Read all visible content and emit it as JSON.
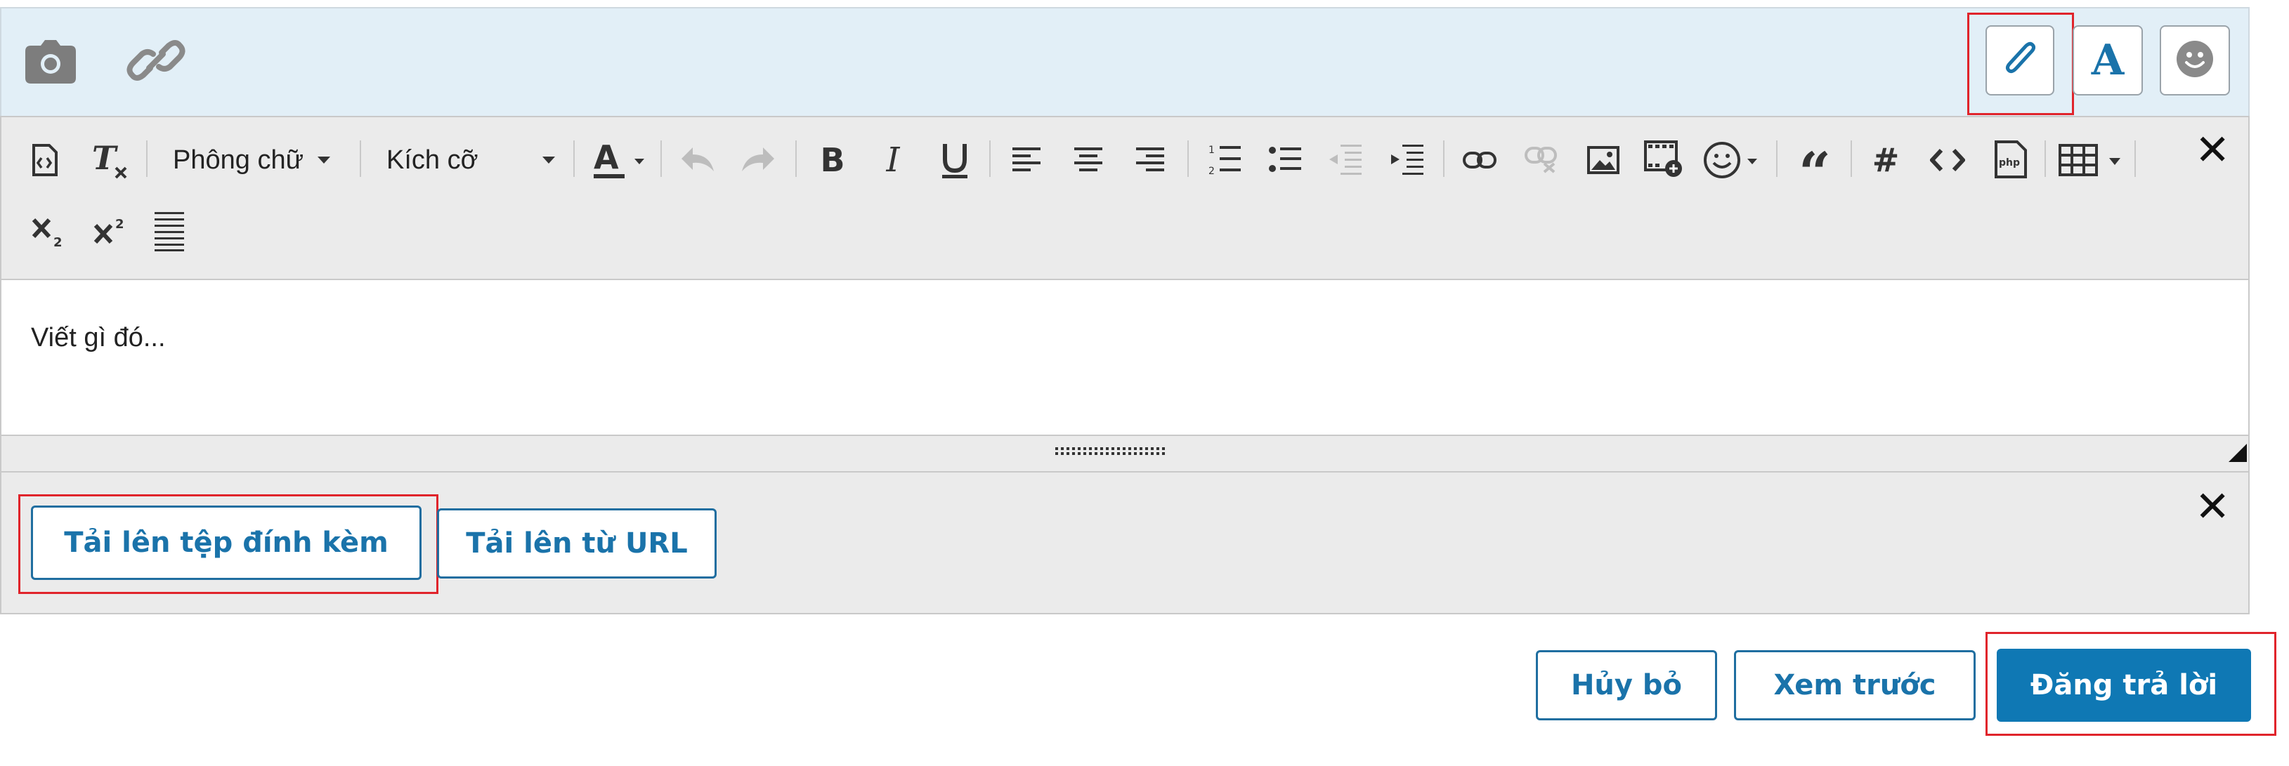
{
  "toolbar_top": {
    "left_icons": [
      "camera-icon",
      "link-icon"
    ],
    "right_icons": [
      "paperclip-icon",
      "font-a-icon",
      "smiley-icon"
    ]
  },
  "format_toolbar": {
    "font_label": "Phông chữ",
    "size_label": "Kích cỡ",
    "icons": [
      "source-icon",
      "remove-format-icon",
      "text-color-icon",
      "undo-icon",
      "redo-icon",
      "bold-icon",
      "italic-icon",
      "underline-icon",
      "align-left-icon",
      "align-center-icon",
      "align-right-icon",
      "ordered-list-icon",
      "unordered-list-icon",
      "outdent-icon",
      "indent-icon",
      "insert-link-icon",
      "unlink-icon",
      "image-icon",
      "media-icon",
      "emoji-icon",
      "quote-icon",
      "hashtag-icon",
      "code-icon",
      "php-icon",
      "table-icon",
      "subscript-icon",
      "superscript-icon",
      "justify-icon",
      "close-icon"
    ]
  },
  "editor": {
    "placeholder": "Viết gì đó..."
  },
  "attachments": {
    "upload_file_label": "Tải lên tệp đính kèm",
    "upload_url_label": "Tải lên từ URL"
  },
  "actions": {
    "cancel_label": "Hủy bỏ",
    "preview_label": "Xem trước",
    "post_label": "Đăng trả lời"
  },
  "colors": {
    "accent": "#0f78b4",
    "highlight": "#e0242b",
    "topbar_bg": "#e2eff7",
    "toolbar_bg": "#ebebeb"
  }
}
